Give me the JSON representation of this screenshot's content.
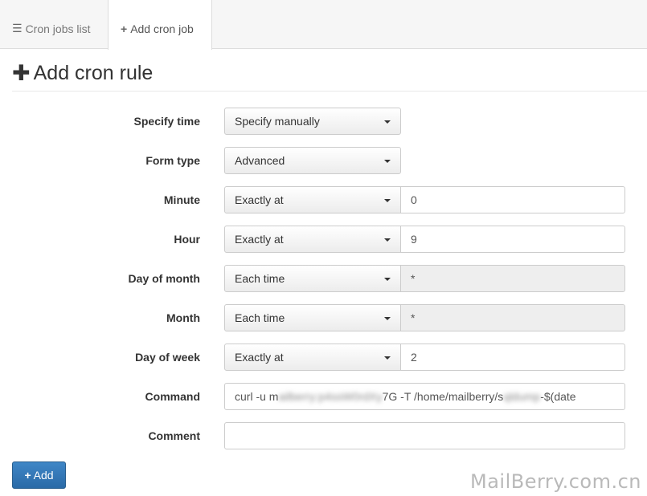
{
  "tabs": {
    "list_icon": "list-icon",
    "list_label": "Cron jobs list",
    "add_icon": "plus-icon",
    "add_label": "Add cron job"
  },
  "page": {
    "title_icon": "plus-icon",
    "title": "Add cron rule"
  },
  "form": {
    "specify_time": {
      "label": "Specify time",
      "value": "Specify manually"
    },
    "form_type": {
      "label": "Form type",
      "value": "Advanced"
    },
    "minute": {
      "label": "Minute",
      "mode": "Exactly at",
      "value": "0"
    },
    "hour": {
      "label": "Hour",
      "mode": "Exactly at",
      "value": "9"
    },
    "day_of_month": {
      "label": "Day of month",
      "mode": "Each time",
      "value": "*"
    },
    "month": {
      "label": "Month",
      "mode": "Each time",
      "value": "*"
    },
    "day_of_week": {
      "label": "Day of week",
      "mode": "Exactly at",
      "value": "2"
    },
    "command": {
      "label": "Command",
      "value_start": "curl -u m",
      "value_redacted_1": "ailberry:p4ssW0rdXy",
      "value_mid": "7G -T /home/mailberry/s",
      "value_redacted_2": "qldump",
      "value_end": "-$(date"
    },
    "comment": {
      "label": "Comment",
      "value": ""
    }
  },
  "actions": {
    "add_icon": "plus-icon",
    "add_label": "Add"
  },
  "watermark": "MailBerry.com.cn",
  "colors": {
    "primary_button": "#337ab7",
    "disabled_input": "#eeeeee",
    "tabbar": "#f6f6f6"
  }
}
